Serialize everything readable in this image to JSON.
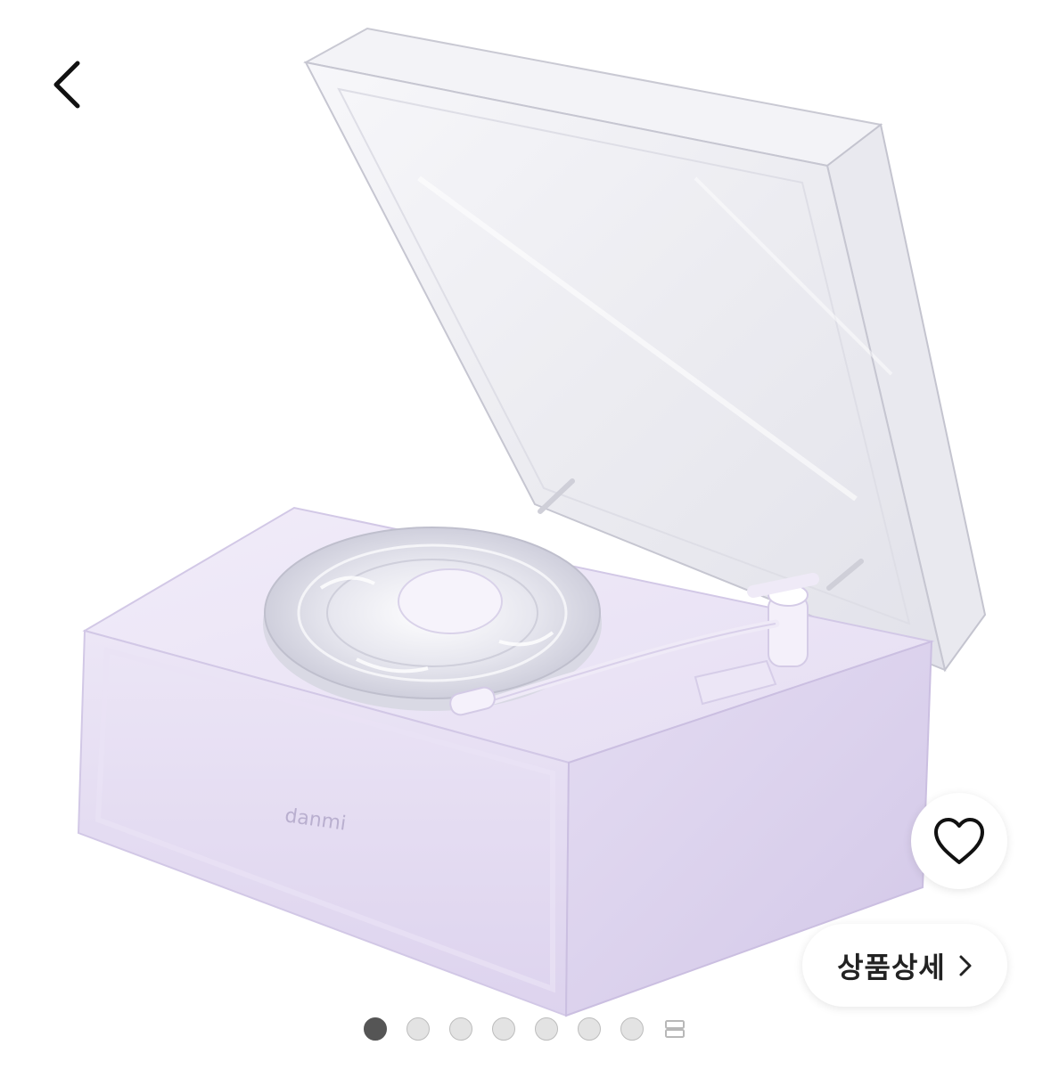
{
  "product": {
    "brand_text": "danmi",
    "image_subject": "transparent-vinyl-record-player"
  },
  "actions": {
    "back_icon": "chevron-left-icon",
    "wish_icon": "heart-outline-icon",
    "detail_label": "상품상세",
    "detail_icon": "chevron-right-icon"
  },
  "pager": {
    "total": 8,
    "current": 1,
    "more_icon": "grid-more-icon"
  },
  "colors": {
    "background": "#ffffff",
    "product_body": "#e7e0f3",
    "dot_active": "#555555",
    "dot_inactive": "#e3e3e3"
  }
}
